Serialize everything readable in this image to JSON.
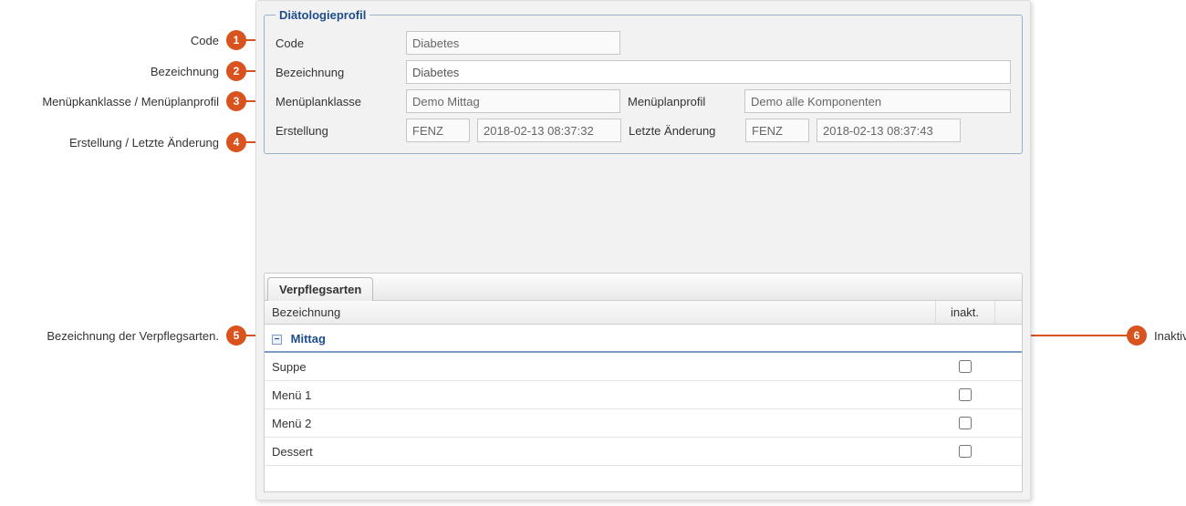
{
  "callouts": {
    "c1": "Code",
    "c2": "Bezeichnung",
    "c3": "Menüpkanklasse / Menüplanprofil",
    "c4": "Erstellung / Letzte Änderung",
    "c5": "Bezeichnung der Verpflegsarten.",
    "c6": "Inaktiv setzen"
  },
  "fieldset": {
    "legend": "Diätologieprofil",
    "labels": {
      "code": "Code",
      "bezeichnung": "Bezeichnung",
      "menuplanklasse": "Menüplanklasse",
      "menuplanprofil": "Menüplanprofil",
      "erstellung": "Erstellung",
      "letzte_aenderung": "Letzte Änderung"
    },
    "values": {
      "code": "Diabetes",
      "bezeichnung": "Diabetes",
      "menuplanklasse": "Demo Mittag",
      "menuplanprofil": "Demo alle Komponenten",
      "erstellung_user": "FENZ",
      "erstellung_ts": "2018-02-13 08:37:32",
      "aenderung_user": "FENZ",
      "aenderung_ts": "2018-02-13 08:37:43"
    }
  },
  "tab": {
    "label": "Verpflegsarten"
  },
  "table": {
    "headers": {
      "bezeichnung": "Bezeichnung",
      "inakt": "inakt."
    },
    "group": "Mittag",
    "rows": [
      {
        "label": "Suppe",
        "inakt": false
      },
      {
        "label": "Menü 1",
        "inakt": false
      },
      {
        "label": "Menü 2",
        "inakt": false
      },
      {
        "label": "Dessert",
        "inakt": false
      }
    ]
  }
}
